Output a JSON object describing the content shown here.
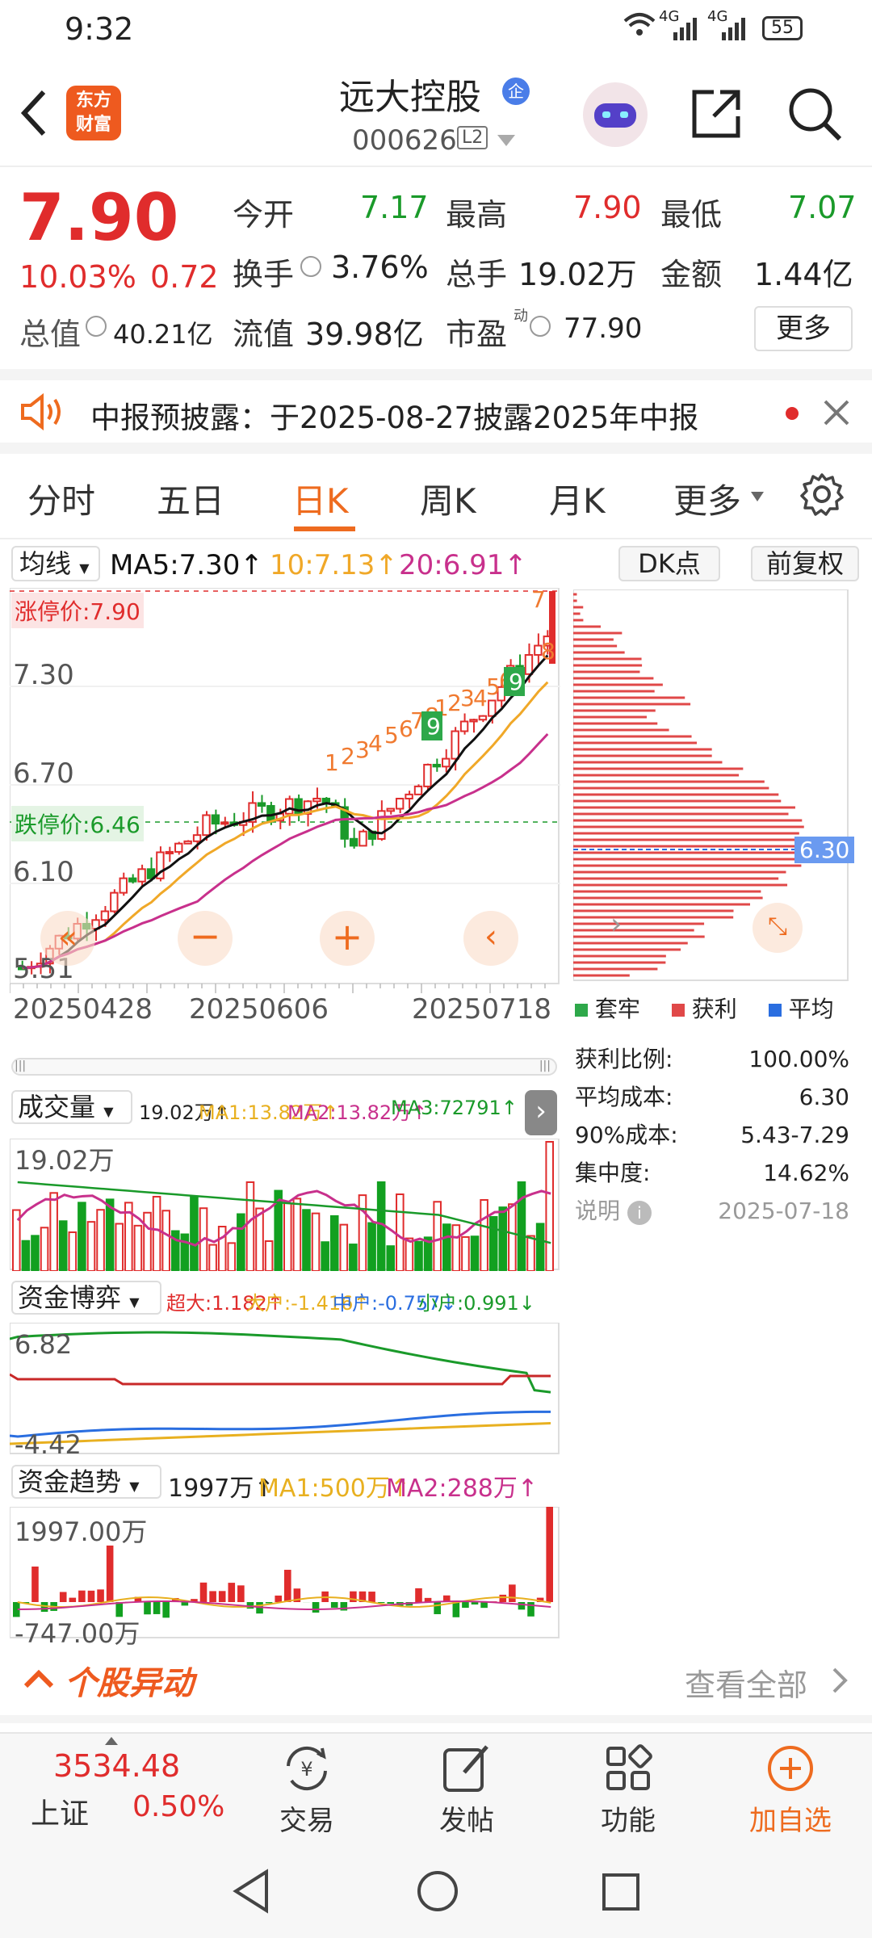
{
  "status_bar": {
    "time": "9:32",
    "network": "4G",
    "network2": "4G",
    "battery": "55"
  },
  "header": {
    "title": "远大控股",
    "title_badge": "企",
    "code": "000626",
    "level": "L2",
    "logo_text_1": "东方",
    "logo_text_2": "财富"
  },
  "quote": {
    "price": "7.90",
    "change_pct": "10.03%",
    "change": "0.72",
    "open_label": "今开",
    "open": "7.17",
    "high_label": "最高",
    "high": "7.90",
    "low_label": "最低",
    "low": "7.07",
    "turnover_label": "换手",
    "turnover": "3.76%",
    "volume_label": "总手",
    "volume": "19.02万",
    "amount_label": "金额",
    "amount": "1.44亿",
    "mktcap_label": "总值",
    "mktcap": "40.21亿",
    "float_label": "流值",
    "float": "39.98亿",
    "pe_label": "市盈",
    "pe_sup": "动",
    "pe": "77.90",
    "more_label": "更多"
  },
  "notice": {
    "text": "中报预披露：于2025-08-27披露2025年中报"
  },
  "tabs": [
    "分时",
    "五日",
    "日K",
    "周K",
    "月K",
    "更多"
  ],
  "active_tab": "日K",
  "kline": {
    "ma_selector": "均线",
    "ma5": "MA5:7.30↑",
    "ma10": "10:7.13↑",
    "ma20": "20:6.91↑",
    "dk_label": "DK点",
    "adj_label": "前复权",
    "limit_up": "涨停价:7.90",
    "limit_down": "跌停价:6.46",
    "y_labels": [
      "7.30",
      "6.70",
      "6.10",
      "5.51"
    ],
    "dates": [
      "20250428",
      "20250606",
      "20250718"
    ],
    "chip_price": "6.30",
    "chip_legend": [
      "套牢",
      "获利",
      "平均"
    ],
    "chip_stats": [
      {
        "label": "获利比例:",
        "value": "100.00%"
      },
      {
        "label": "平均成本:",
        "value": "6.30"
      },
      {
        "label": "90%成本:",
        "value": "5.43-7.29"
      },
      {
        "label": "集中度:",
        "value": "14.62%"
      }
    ],
    "chip_note": "说明",
    "chip_date": "2025-07-18"
  },
  "volume": {
    "selector": "成交量",
    "val": "19.02万↑",
    "ma1": "MA1:13.82万↑",
    "ma2": "MA2:13.82万↑",
    "ma3": "MA3:72791↑",
    "y_top": "19.02万"
  },
  "fund_game": {
    "selector": "资金博弈",
    "super": "超大:1.182↑",
    "big": "大户:-1.416↑",
    "mid": "中户:-0.757↓",
    "small": "小户:0.991↓",
    "y_top": "6.82",
    "y_bottom": "-4.42"
  },
  "fund_trend": {
    "selector": "资金趋势",
    "val": "1997万↑",
    "ma1": "MA1:500万↑",
    "ma2": "MA2:288万↑",
    "y_top": "1997.00万",
    "y_bottom": "-747.00万"
  },
  "movement": {
    "title": "个股异动",
    "view_all": "查看全部"
  },
  "bottom_nav": {
    "index_value": "3534.48",
    "index_name": "上证",
    "index_pct": "0.50%",
    "trade": "交易",
    "post": "发帖",
    "func": "功能",
    "add": "加自选"
  },
  "colors": {
    "up": "#e02c2c",
    "down": "#1a9a2a",
    "accent": "#ee6b1f",
    "ma5": "#111111",
    "ma10": "#f0a828",
    "ma20": "#c8308c"
  }
}
